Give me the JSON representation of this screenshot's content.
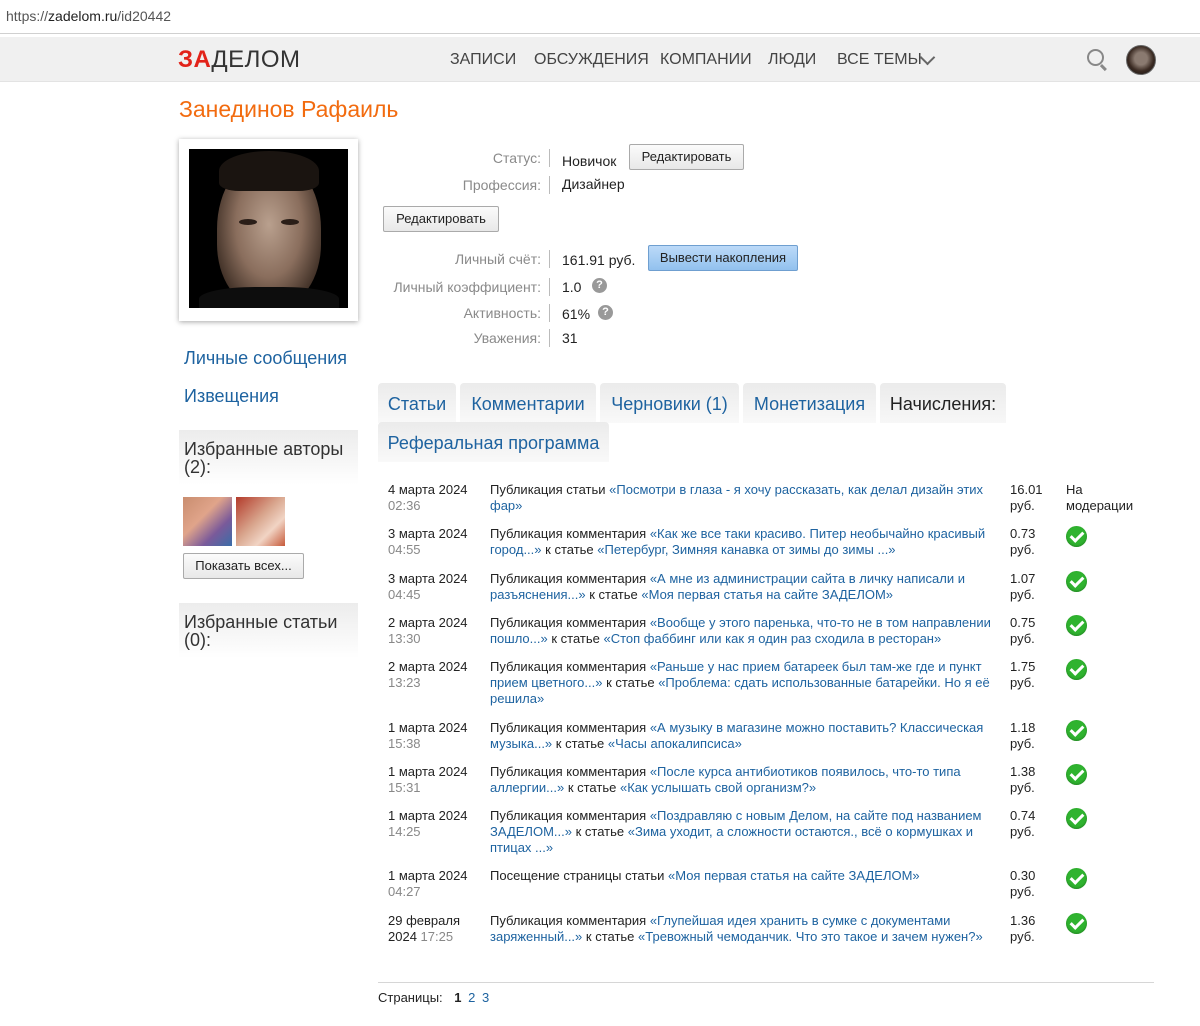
{
  "browser": {
    "url_scheme": "https://",
    "url_host": "zadelom.ru",
    "url_path": "/id20442"
  },
  "nav": {
    "logo_accent": "ЗА",
    "logo_rest": "ДЕЛОМ",
    "items": [
      "ЗАПИСИ",
      "ОБСУЖДЕНИЯ",
      "КОМПАНИИ",
      "ЛЮДИ",
      "ВСЕ ТЕМЫ"
    ]
  },
  "profile": {
    "name": "Занединов Рафаиль",
    "status_label": "Статус:",
    "status_value": "Новичок",
    "edit_status_label": "Редактировать",
    "profession_label": "Профессия:",
    "profession_value": "Дизайнер",
    "edit_label": "Редактировать",
    "account_label": "Личный счёт:",
    "account_value": "161.91 руб.",
    "withdraw_label": "Вывести накопления",
    "coef_label": "Личный коэффициент:",
    "coef_value": "1.0",
    "activity_label": "Активность:",
    "activity_value": "61%",
    "respect_label": "Уважения:",
    "respect_value": "31"
  },
  "sidebar": {
    "messages": "Личные сообщения",
    "notifications": "Извещения",
    "fav_authors": "Избранные авторы (2):",
    "show_all": "Показать всех...",
    "fav_articles": "Избранные статьи (0):"
  },
  "tabs": [
    "Статьи",
    "Комментарии",
    "Черновики (1)",
    "Монетизация",
    "Начисления:",
    "Реферальная программа"
  ],
  "accruals": [
    {
      "date": "4 марта 2024",
      "time": "02:36",
      "type": "Публикация статьи",
      "link": "«Посмотри в глаза - я хочу рассказать, как делал дизайн этих фар»",
      "mid": "",
      "link2": "",
      "amount": "16.01",
      "unit": "руб.",
      "status": "На модерации"
    },
    {
      "date": "3 марта 2024",
      "time": "04:55",
      "type": "Публикация комментария",
      "link": "«Как же все таки красиво. Питер необычайно красивый город...»",
      "mid": "к статье",
      "link2": "«Петербург, Зимняя канавка от зимы до зимы ...»",
      "amount": "0.73",
      "unit": "руб.",
      "status": ""
    },
    {
      "date": "3 марта 2024",
      "time": "04:45",
      "type": "Публикация комментария",
      "link": "«А мне из администрации сайта в личку написали и разъяснения...»",
      "mid": "к статье",
      "link2": "«Моя первая статья на сайте ЗАДЕЛОМ»",
      "amount": "1.07",
      "unit": "руб.",
      "status": ""
    },
    {
      "date": "2 марта 2024",
      "time": "13:30",
      "type": "Публикация комментария",
      "link": "«Вообще у этого паренька, что-то не в том направлении пошло...»",
      "mid": "к статье",
      "link2": "«Стоп фаббинг или как я один раз сходила в ресторан»",
      "amount": "0.75",
      "unit": "руб.",
      "status": ""
    },
    {
      "date": "2 марта 2024",
      "time": "13:23",
      "type": "Публикация комментария",
      "link": "«Раньше у нас прием батареек был там-же где и пункт прием цветного...»",
      "mid": "к статье",
      "link2": "«Проблема: сдать использованные батарейки. Но я её решила»",
      "amount": "1.75",
      "unit": "руб.",
      "status": ""
    },
    {
      "date": "1 марта 2024",
      "time": "15:38",
      "type": "Публикация комментария",
      "link": "«А музыку в магазине можно поставить? Классическая музыка...»",
      "mid": "к статье",
      "link2": "«Часы апокалипсиса»",
      "amount": "1.18",
      "unit": "руб.",
      "status": ""
    },
    {
      "date": "1 марта 2024",
      "time": "15:31",
      "type": "Публикация комментария",
      "link": "«После курса антибиотиков появилось, что-то типа аллергии...»",
      "mid": "к статье",
      "link2": "«Как услышать свой организм?»",
      "amount": "1.38",
      "unit": "руб.",
      "status": ""
    },
    {
      "date": "1 марта 2024",
      "time": "14:25",
      "type": "Публикация комментария",
      "link": "«Поздравляю с новым Делом, на сайте под названием ЗАДЕЛОМ...»",
      "mid": "к статье",
      "link2": "«Зима уходит, а сложности остаются., всё о кормушках и птицах ...»",
      "amount": "0.74",
      "unit": "руб.",
      "status": ""
    },
    {
      "date": "1 марта 2024",
      "time": "04:27",
      "type": "Посещение страницы статьи",
      "link": "«Моя первая статья на сайте ЗАДЕЛОМ»",
      "mid": "",
      "link2": "",
      "amount": "0.30",
      "unit": "руб.",
      "status": ""
    },
    {
      "date": "29 февраля 2024",
      "time": "17:25",
      "type": "Публикация комментария",
      "link": "«Глупейшая идея хранить в сумке с документами заряженный...»",
      "mid": "к статье",
      "link2": "«Тревожный чемоданчик. Что это такое и зачем нужен?»",
      "amount": "1.36",
      "unit": "руб.",
      "status": ""
    }
  ],
  "pagination": {
    "label": "Страницы:",
    "current": "1",
    "pages": [
      "2",
      "3"
    ]
  },
  "colors": {
    "accent": "#f26b0f",
    "logo_red": "#e2231a",
    "link": "#1e63a0",
    "ok_green": "#2fb32f"
  }
}
